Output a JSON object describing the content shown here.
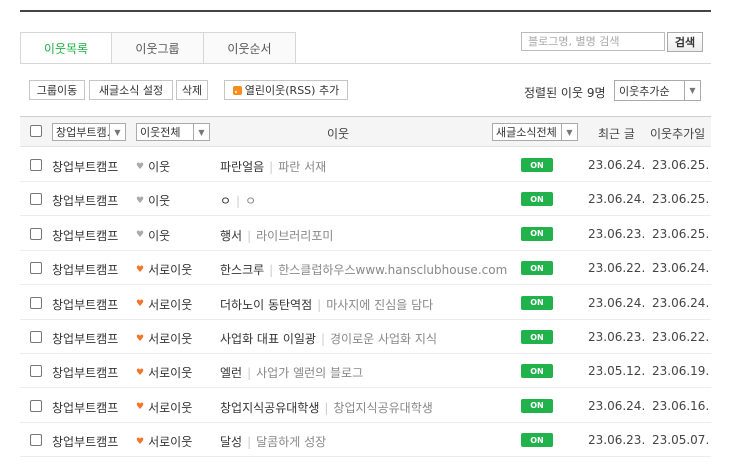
{
  "tabs": [
    {
      "label": "이웃목록",
      "active": true
    },
    {
      "label": "이웃그룹",
      "active": false
    },
    {
      "label": "이웃순서",
      "active": false
    }
  ],
  "search": {
    "placeholder": "블로그명, 별명 검색",
    "button": "검색"
  },
  "toolbar": {
    "group_move": "그룹이동",
    "new_post_setting": "새글소식 설정",
    "delete": "삭제",
    "rss_add": "열린이웃(RSS) 추가"
  },
  "sort": {
    "label": "정렬된 이웃 9명",
    "selected": "이웃추가순"
  },
  "header": {
    "group_select": "창업부트캠...",
    "neighbor_select": "이웃전체",
    "neighbor_col": "이웃",
    "news_select": "새글소식전체",
    "recent_post": "최근 글",
    "added_date": "이웃추가일"
  },
  "colors": {
    "accent": "#1eb046",
    "on_badge": "#22b24c",
    "heart_mutual": "#f2752c",
    "heart_one_way": "#aaaaaa"
  },
  "rows": [
    {
      "group": "창업부트캠프",
      "relation": "이웃",
      "mutual": false,
      "nickname": "파란얼음",
      "blog": "파란 서재",
      "news": "ON",
      "recent": "23.06.24.",
      "added": "23.06.25."
    },
    {
      "group": "창업부트캠프",
      "relation": "이웃",
      "mutual": false,
      "nickname": "ㅇ",
      "blog": "ㅇ",
      "news": "ON",
      "recent": "23.06.24.",
      "added": "23.06.25."
    },
    {
      "group": "창업부트캠프",
      "relation": "이웃",
      "mutual": false,
      "nickname": "행서",
      "blog": "라이브러리포미",
      "news": "ON",
      "recent": "23.06.23.",
      "added": "23.06.25."
    },
    {
      "group": "창업부트캠프",
      "relation": "서로이웃",
      "mutual": true,
      "nickname": "한스크루",
      "blog": "한스클럽하우스www.hansclubhouse.com",
      "news": "ON",
      "recent": "23.06.22.",
      "added": "23.06.24."
    },
    {
      "group": "창업부트캠프",
      "relation": "서로이웃",
      "mutual": true,
      "nickname": "더하노이 동탄역점",
      "blog": "마사지에 진심을 담다",
      "news": "ON",
      "recent": "23.06.24.",
      "added": "23.06.24."
    },
    {
      "group": "창업부트캠프",
      "relation": "서로이웃",
      "mutual": true,
      "nickname": "사업화 대표 이일광",
      "blog": "경이로운 사업화 지식",
      "news": "ON",
      "recent": "23.06.23.",
      "added": "23.06.22."
    },
    {
      "group": "창업부트캠프",
      "relation": "서로이웃",
      "mutual": true,
      "nickname": "엘런",
      "blog": "사업가 엘런의 블로그",
      "news": "ON",
      "recent": "23.05.12.",
      "added": "23.06.19."
    },
    {
      "group": "창업부트캠프",
      "relation": "서로이웃",
      "mutual": true,
      "nickname": "창업지식공유대학생",
      "blog": "창업지식공유대학생",
      "news": "ON",
      "recent": "23.06.24.",
      "added": "23.06.16."
    },
    {
      "group": "창업부트캠프",
      "relation": "서로이웃",
      "mutual": true,
      "nickname": "달성",
      "blog": "달콤하게 성장",
      "news": "ON",
      "recent": "23.06.23.",
      "added": "23.05.07."
    }
  ]
}
